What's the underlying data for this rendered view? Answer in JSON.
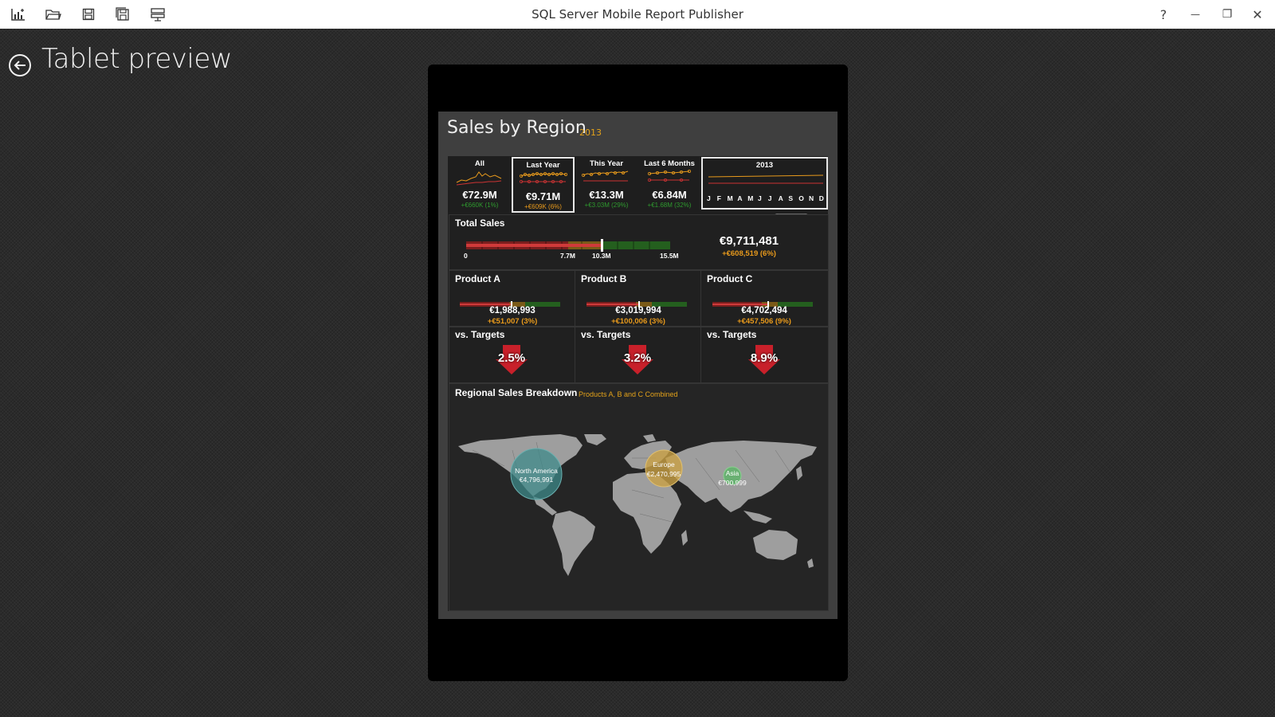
{
  "window": {
    "title": "SQL Server Mobile Report Publisher",
    "help_glyph": "?",
    "minimize_glyph": "—",
    "restore_glyph": "❐",
    "close_glyph": "✕",
    "toolbar_icons": [
      "new-report-icon",
      "open-folder-icon",
      "save-icon",
      "save-as-icon",
      "publish-icon"
    ]
  },
  "page": {
    "title": "Tablet preview"
  },
  "dashboard": {
    "title": "Sales by Region",
    "year": "2013",
    "filters": [
      {
        "label": "All",
        "value": "€72.9M",
        "delta": "+€660K (1%)",
        "delta_color": "#2f9a2f",
        "selected": false
      },
      {
        "label": "Last Year",
        "value": "€9.71M",
        "delta": "+€609K (6%)",
        "delta_color": "#e89a1c",
        "selected": true
      },
      {
        "label": "This Year",
        "value": "€13.3M",
        "delta": "+€3.03M (29%)",
        "delta_color": "#2f9a2f",
        "selected": false
      },
      {
        "label": "Last 6 Months",
        "value": "€6.84M",
        "delta": "+€1.68M (32%)",
        "delta_color": "#2f9a2f",
        "selected": false
      }
    ],
    "timeline": {
      "year": "2013",
      "months": [
        "J",
        "F",
        "M",
        "A",
        "M",
        "J",
        "J",
        "A",
        "S",
        "O",
        "N",
        "D"
      ]
    },
    "total_sales": {
      "label": "Total Sales",
      "value": "€9,711,481",
      "delta": "+€608,519 (6%)",
      "ticks": [
        "0",
        "7.7M",
        "10.3M",
        "15.5M"
      ],
      "gauge_value_fraction": 0.66
    },
    "products": [
      {
        "name": "Product A",
        "value": "€1,988,993",
        "delta": "+€51,007 (3%)",
        "target_label": "vs. Targets",
        "target_pct": "2.5%"
      },
      {
        "name": "Product B",
        "value": "€3,019,994",
        "delta": "+€100,006 (3%)",
        "target_label": "vs. Targets",
        "target_pct": "3.2%"
      },
      {
        "name": "Product C",
        "value": "€4,702,494",
        "delta": "+€457,506 (9%)",
        "target_label": "vs. Targets",
        "target_pct": "8.9%"
      }
    ],
    "regional": {
      "title": "Regional Sales Breakdown",
      "subtitle": "Products A, B and C Combined",
      "bubbles": [
        {
          "region": "North America",
          "value": "€4,796,991",
          "color": "#3d8a8a"
        },
        {
          "region": "Europe",
          "value": "€2,470,995",
          "color": "#c9a044"
        },
        {
          "region": "Asia",
          "value": "€700,999",
          "color": "#5fb36a"
        }
      ]
    }
  },
  "colors": {
    "accent_orange": "#e89a1c",
    "accent_green": "#2f9a2f",
    "target_red": "#c8202a"
  }
}
